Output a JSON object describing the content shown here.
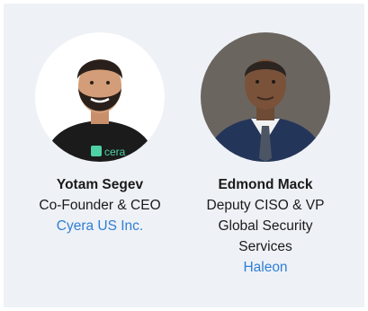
{
  "speakers": [
    {
      "name": "Yotam Segev",
      "title_lines": [
        "Co-Founder & CEO"
      ],
      "company": "Cyera US Inc.",
      "shirt_logo": "cera"
    },
    {
      "name": "Edmond Mack",
      "title_lines": [
        "Deputy CISO & VP",
        "Global Security",
        "Services"
      ],
      "company": "Haleon"
    }
  ],
  "colors": {
    "card_background": "#eef1f6",
    "link": "#2f7fd4",
    "text": "#1a1a1a"
  }
}
